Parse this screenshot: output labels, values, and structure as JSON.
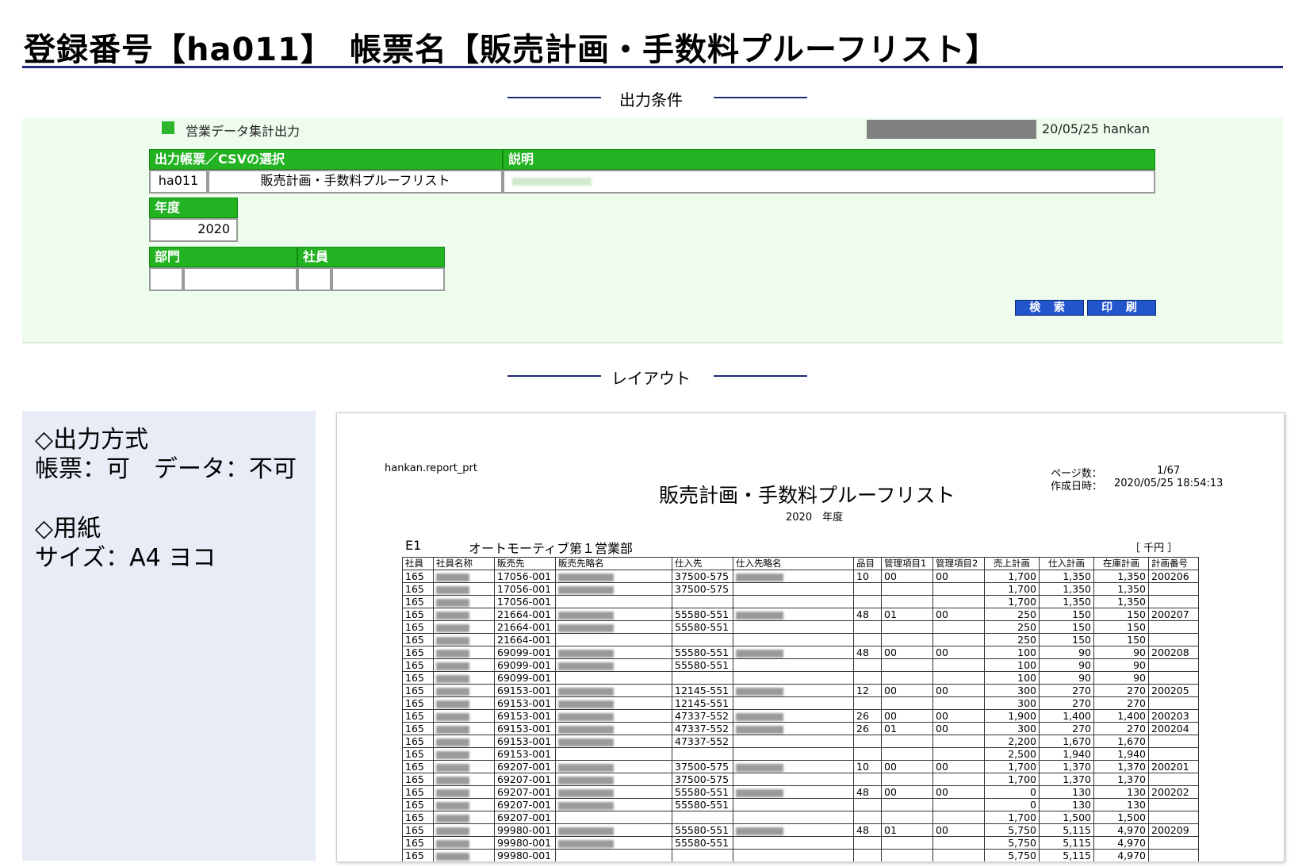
{
  "header": {
    "title": "登録番号【ha011】　帳票名【販売計画・手数料プルーフリスト】"
  },
  "sections": {
    "output_conditions": "出力条件",
    "layout": "レイアウト"
  },
  "form": {
    "legend": "営業データ集計出力",
    "user_stamp": "20/05/25 hankan",
    "select_header": "出力帳票／CSVの選択",
    "desc_header": "説明",
    "report_code": "ha011",
    "report_name": "販売計画・手数料プルーフリスト",
    "year_header": "年度",
    "year_value": "2020",
    "dept_header": "部門",
    "emp_header": "社員",
    "search_label": "検 索",
    "print_label": "印 刷",
    "colors": {
      "header_green": "#22b222",
      "panel_bg": "#eefcee",
      "button_blue": "#2255cc"
    }
  },
  "side": {
    "line1": "◇出力方式",
    "line2": "帳票：可　データ：不可",
    "line3": "◇用紙",
    "line4": "サイズ：A4 ヨコ"
  },
  "report": {
    "prog": "hankan.report_prt",
    "title": "販売計画・手数料プルーフリスト",
    "year": "2020　年度",
    "page_label": "ページ数：",
    "page_value": "1/67",
    "created_label": "作成日時：",
    "created_value": "2020/05/25 18:54:13",
    "dept_code": "E1",
    "dept_name": "オートモーティブ第１営業部",
    "unit": "［ 千円 ］",
    "columns": [
      "社員",
      "社員名称",
      "販売先",
      "販売先略名",
      "仕入先",
      "仕入先略名",
      "品目",
      "管理項目1",
      "管理項目2",
      "売上計画",
      "仕入計画",
      "在庫計画",
      "計画番号"
    ],
    "rows": [
      [
        "165",
        "",
        "17056-001",
        "",
        "37500-575",
        "",
        "10",
        "00",
        "00",
        "1,700",
        "1,350",
        "1,350",
        "200206"
      ],
      [
        "165",
        "",
        "17056-001",
        "",
        "37500-575",
        "",
        "",
        "",
        "",
        "1,700",
        "1,350",
        "1,350",
        ""
      ],
      [
        "165",
        "",
        "17056-001",
        "",
        "",
        "",
        "",
        "",
        "",
        "1,700",
        "1,350",
        "1,350",
        ""
      ],
      [
        "165",
        "",
        "21664-001",
        "",
        "55580-551",
        "",
        "48",
        "01",
        "00",
        "250",
        "150",
        "150",
        "200207"
      ],
      [
        "165",
        "",
        "21664-001",
        "",
        "55580-551",
        "",
        "",
        "",
        "",
        "250",
        "150",
        "150",
        ""
      ],
      [
        "165",
        "",
        "21664-001",
        "",
        "",
        "",
        "",
        "",
        "",
        "250",
        "150",
        "150",
        ""
      ],
      [
        "165",
        "",
        "69099-001",
        "",
        "55580-551",
        "",
        "48",
        "00",
        "00",
        "100",
        "90",
        "90",
        "200208"
      ],
      [
        "165",
        "",
        "69099-001",
        "",
        "55580-551",
        "",
        "",
        "",
        "",
        "100",
        "90",
        "90",
        ""
      ],
      [
        "165",
        "",
        "69099-001",
        "",
        "",
        "",
        "",
        "",
        "",
        "100",
        "90",
        "90",
        ""
      ],
      [
        "165",
        "",
        "69153-001",
        "",
        "12145-551",
        "",
        "12",
        "00",
        "00",
        "300",
        "270",
        "270",
        "200205"
      ],
      [
        "165",
        "",
        "69153-001",
        "",
        "12145-551",
        "",
        "",
        "",
        "",
        "300",
        "270",
        "270",
        ""
      ],
      [
        "165",
        "",
        "69153-001",
        "",
        "47337-552",
        "",
        "26",
        "00",
        "00",
        "1,900",
        "1,400",
        "1,400",
        "200203"
      ],
      [
        "165",
        "",
        "69153-001",
        "",
        "47337-552",
        "",
        "26",
        "01",
        "00",
        "300",
        "270",
        "270",
        "200204"
      ],
      [
        "165",
        "",
        "69153-001",
        "",
        "47337-552",
        "",
        "",
        "",
        "",
        "2,200",
        "1,670",
        "1,670",
        ""
      ],
      [
        "165",
        "",
        "69153-001",
        "",
        "",
        "",
        "",
        "",
        "",
        "2,500",
        "1,940",
        "1,940",
        ""
      ],
      [
        "165",
        "",
        "69207-001",
        "",
        "37500-575",
        "",
        "10",
        "00",
        "00",
        "1,700",
        "1,370",
        "1,370",
        "200201"
      ],
      [
        "165",
        "",
        "69207-001",
        "",
        "37500-575",
        "",
        "",
        "",
        "",
        "1,700",
        "1,370",
        "1,370",
        ""
      ],
      [
        "165",
        "",
        "69207-001",
        "",
        "55580-551",
        "",
        "48",
        "00",
        "00",
        "0",
        "130",
        "130",
        "200202"
      ],
      [
        "165",
        "",
        "69207-001",
        "",
        "55580-551",
        "",
        "",
        "",
        "",
        "0",
        "130",
        "130",
        ""
      ],
      [
        "165",
        "",
        "69207-001",
        "",
        "",
        "",
        "",
        "",
        "",
        "1,700",
        "1,500",
        "1,500",
        ""
      ],
      [
        "165",
        "",
        "99980-001",
        "",
        "55580-551",
        "",
        "48",
        "01",
        "00",
        "5,750",
        "5,115",
        "4,970",
        "200209"
      ],
      [
        "165",
        "",
        "99980-001",
        "",
        "55580-551",
        "",
        "",
        "",
        "",
        "5,750",
        "5,115",
        "4,970",
        ""
      ],
      [
        "165",
        "",
        "99980-001",
        "",
        "",
        "",
        "",
        "",
        "",
        "5,750",
        "5,115",
        "4,970",
        ""
      ]
    ]
  }
}
